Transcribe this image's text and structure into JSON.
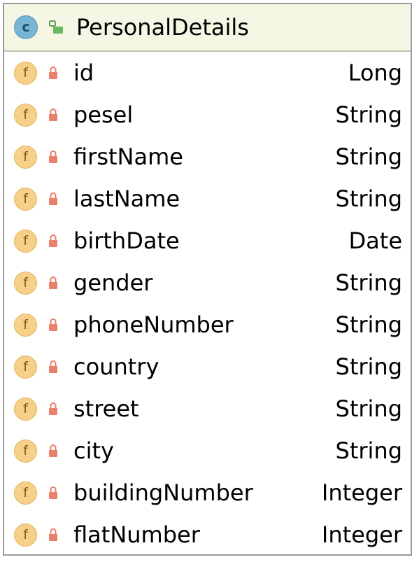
{
  "class": {
    "name": "PersonalDetails",
    "icon": "class-icon",
    "icon_letter": "c",
    "visibility_icon": "public-icon"
  },
  "fields": [
    {
      "name": "id",
      "type": "Long"
    },
    {
      "name": "pesel",
      "type": "String"
    },
    {
      "name": "firstName",
      "type": "String"
    },
    {
      "name": "lastName",
      "type": "String"
    },
    {
      "name": "birthDate",
      "type": "Date"
    },
    {
      "name": "gender",
      "type": "String"
    },
    {
      "name": "phoneNumber",
      "type": "String"
    },
    {
      "name": "country",
      "type": "String"
    },
    {
      "name": "street",
      "type": "String"
    },
    {
      "name": "city",
      "type": "String"
    },
    {
      "name": "buildingNumber",
      "type": "Integer"
    },
    {
      "name": "flatNumber",
      "type": "Integer"
    }
  ],
  "field_icon": "field-icon",
  "field_icon_letter": "f",
  "field_visibility_icon": "private-lock-icon",
  "colors": {
    "header_bg": "#f6f6e4",
    "class_icon": "#78b4d4",
    "field_icon": "#f6d089",
    "lock": "#e8806a",
    "border": "#9a9a9a"
  }
}
